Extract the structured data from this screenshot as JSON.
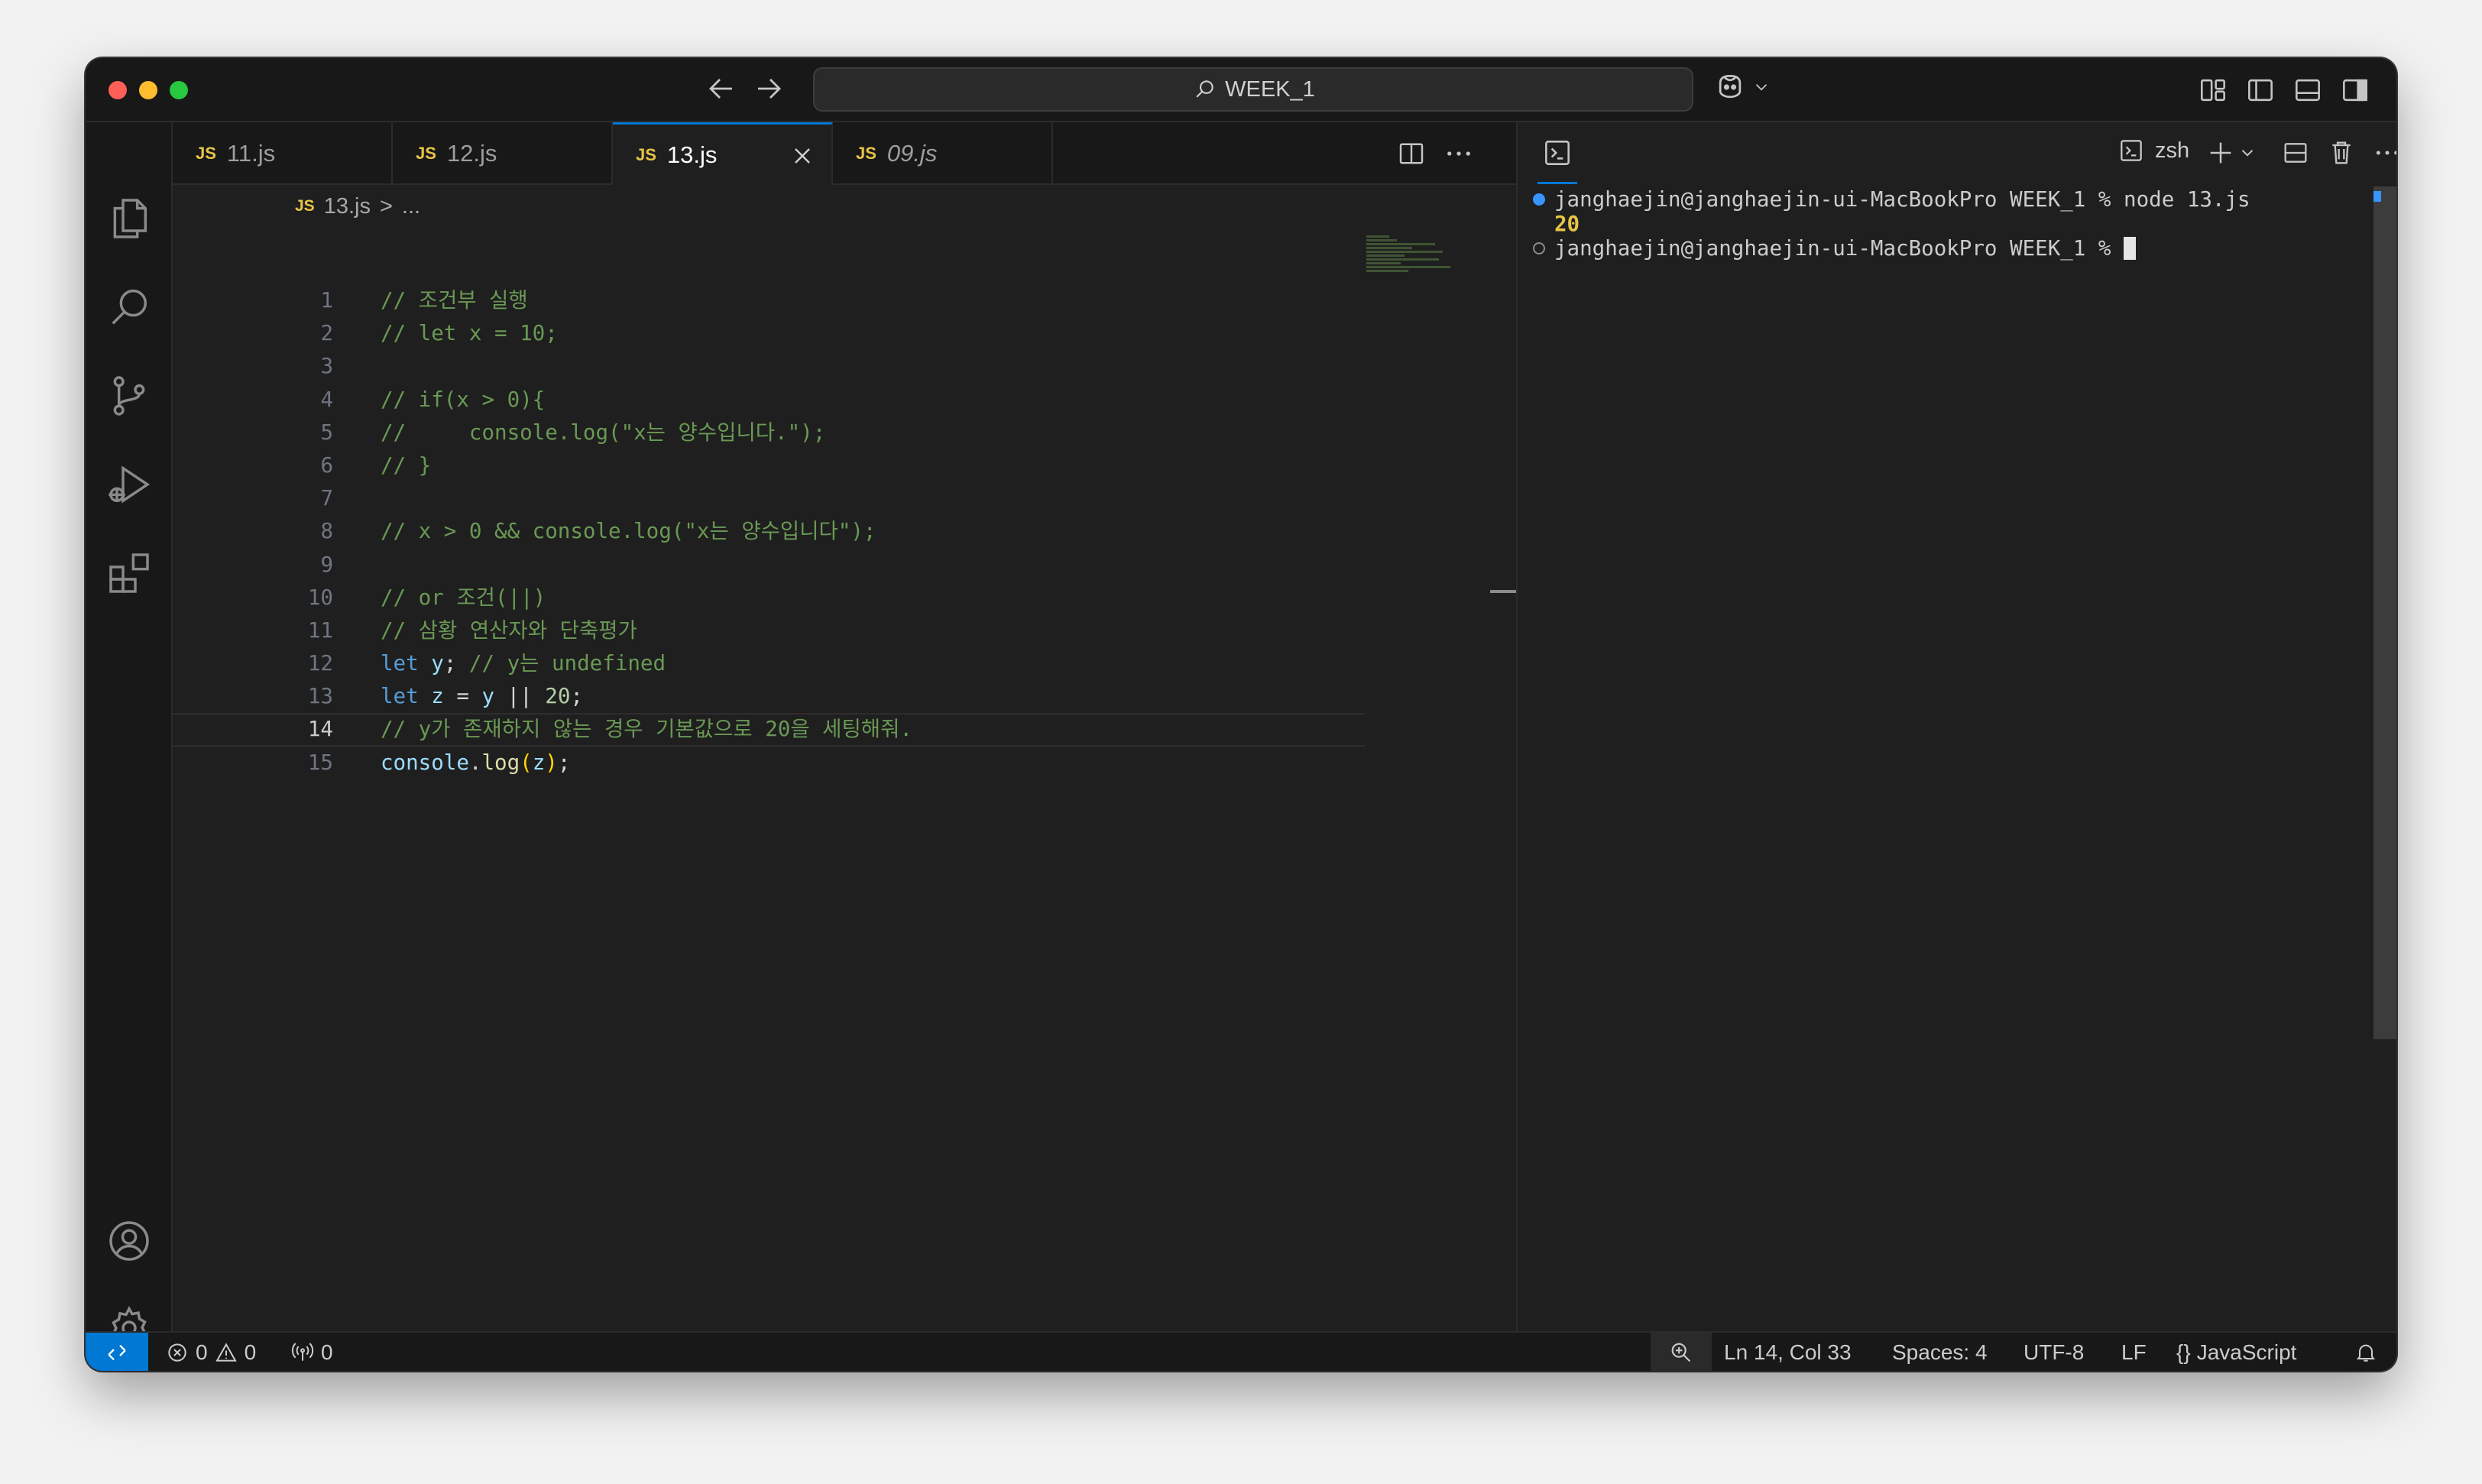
{
  "titlebar": {
    "search_text": "WEEK_1"
  },
  "tabs": [
    {
      "label": "11.js",
      "badge": "JS",
      "active": false
    },
    {
      "label": "12.js",
      "badge": "JS",
      "active": false
    },
    {
      "label": "13.js",
      "badge": "JS",
      "active": true
    },
    {
      "label": "09.js",
      "badge": "JS",
      "active": false
    }
  ],
  "breadcrumb": {
    "badge": "JS",
    "file": "13.js",
    "separator": ">",
    "rest": "..."
  },
  "editor": {
    "lines": [
      {
        "n": "1",
        "text": "// 조건부 실행"
      },
      {
        "n": "2",
        "text": "// let x = 10;"
      },
      {
        "n": "3",
        "text": ""
      },
      {
        "n": "4",
        "text": "// if(x > 0){"
      },
      {
        "n": "5",
        "text": "//     console.log(\"x는 양수입니다.\");"
      },
      {
        "n": "6",
        "text": "// }"
      },
      {
        "n": "7",
        "text": ""
      },
      {
        "n": "8",
        "text": "// x > 0 && console.log(\"x는 양수입니다\");"
      },
      {
        "n": "9",
        "text": ""
      },
      {
        "n": "10",
        "text": "// or 조건(||)"
      },
      {
        "n": "11",
        "text": "// 삼황 연산자와 단축평가"
      },
      {
        "n": "12",
        "kw": "let",
        "var": "y",
        "punct": ";",
        "comment": "// y는 undefined"
      },
      {
        "n": "13",
        "kw": "let",
        "var": "z",
        "eq": " = ",
        "var2": "y",
        "op": " || ",
        "num": "20",
        "end": ";"
      },
      {
        "n": "14",
        "text": "// y가 존재하지 않는 경우 기본값으로 20을 세팅해줘."
      },
      {
        "n": "15",
        "obj": "console",
        "dot": ".",
        "fn": "log",
        "open": "(",
        "arg": "z",
        "close": ")",
        "end": ";"
      }
    ]
  },
  "terminal": {
    "shell_name": "zsh",
    "lines": [
      {
        "text": "janghaejin@janghaejin-ui-MacBookPro WEEK_1 % node 13.js"
      },
      {
        "text": "20"
      },
      {
        "text": "janghaejin@janghaejin-ui-MacBookPro WEEK_1 % "
      }
    ]
  },
  "statusbar": {
    "errors": "0",
    "warnings": "0",
    "ports": "0",
    "position": "Ln 14, Col 33",
    "spaces": "Spaces: 4",
    "encoding": "UTF-8",
    "eol": "LF",
    "language_icon": "{}",
    "language": "JavaScript"
  },
  "colors": {
    "accent": "#0078d4",
    "js_badge": "#e8c547",
    "comment": "#6a9955",
    "keyword": "#569cd6"
  },
  "icons": [
    "back-arrow-icon",
    "forward-arrow-icon",
    "search-icon",
    "copilot-icon",
    "explorer-icon",
    "search-icon",
    "source-control-icon",
    "run-debug-icon",
    "extensions-icon",
    "account-icon",
    "settings-gear-icon",
    "split-editor-icon",
    "more-icon",
    "close-icon",
    "terminal-icon",
    "plus-icon",
    "trash-icon",
    "bell-icon"
  ]
}
